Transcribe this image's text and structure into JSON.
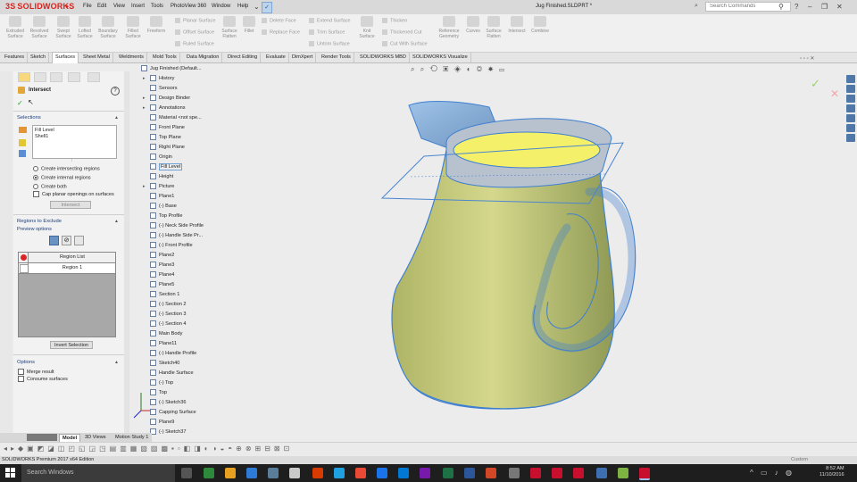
{
  "app": {
    "brand": "SOLIDWORKS",
    "brand_prefix": "3S",
    "document_title": "Jug Finished.SLDPRT *"
  },
  "menu": [
    "File",
    "Edit",
    "View",
    "Insert",
    "Tools",
    "PhotoView 360",
    "Window",
    "Help"
  ],
  "search": {
    "placeholder": "Search Commands"
  },
  "ribbon": {
    "big_buttons": [
      {
        "label": "Extruded Surface"
      },
      {
        "label": "Revolved Surface"
      },
      {
        "label": "Swept Surface"
      },
      {
        "label": "Lofted Surface"
      },
      {
        "label": "Boundary Surface"
      },
      {
        "label": "Filled Surface"
      },
      {
        "label": "Freeform"
      }
    ],
    "small_col1": [
      "Planar Surface",
      "Offset Surface",
      "Ruled Surface"
    ],
    "big2": [
      {
        "label": "Surface Flatten"
      },
      {
        "label": "Fillet"
      }
    ],
    "small_col2": [
      "Delete Face",
      "Replace Face"
    ],
    "small_col3": [
      "Extend Surface",
      "Trim Surface",
      "Untrim Surface"
    ],
    "big3": [
      {
        "label": "Knit Surface"
      }
    ],
    "small_col4": [
      "Thicken",
      "Thickened Cut",
      "Cut With Surface"
    ],
    "big4": [
      {
        "label": "Reference Geometry"
      },
      {
        "label": "Curves"
      },
      {
        "label": "Surface Flatten"
      },
      {
        "label": "Intersect"
      },
      {
        "label": "Combine"
      }
    ]
  },
  "tabs": [
    "Features",
    "Sketch",
    "Surfaces",
    "Sheet Metal",
    "Weldments",
    "Mold Tools",
    "Data Migration",
    "Direct Editing",
    "Evaluate",
    "DimXpert",
    "Render Tools",
    "SOLIDWORKS MBD",
    "SOLIDWORKS Visualize"
  ],
  "active_tab": "Surfaces",
  "property_manager": {
    "title": "Intersect",
    "help": "?",
    "selections_header": "Selections",
    "selections": [
      "Fill Level",
      "Shell1"
    ],
    "options_radio": [
      {
        "label": "Create intersecting regions",
        "checked": false
      },
      {
        "label": "Create internal regions",
        "checked": true
      },
      {
        "label": "Create both",
        "checked": false
      }
    ],
    "cap_label": "Cap planar openings on surfaces",
    "intersect_button": "Intersect",
    "regions_header": "Regions to Exclude",
    "preview_label": "Preview options",
    "region_list_header": "Region List",
    "region_row": "Region   1",
    "invert_button": "Invert Selection",
    "options_header": "Options",
    "merge_label": "Merge result",
    "consume_label": "Consume surfaces"
  },
  "tree": [
    {
      "label": "Jug Finished  (Default...",
      "arrow": "",
      "indent": 0
    },
    {
      "label": "History",
      "arrow": "▸",
      "indent": 1
    },
    {
      "label": "Sensors",
      "arrow": "",
      "indent": 1
    },
    {
      "label": "Design Binder",
      "arrow": "▸",
      "indent": 1
    },
    {
      "label": "Annotations",
      "arrow": "▸",
      "indent": 1
    },
    {
      "label": "Material <not spe...",
      "arrow": "",
      "indent": 1
    },
    {
      "label": "Front Plane",
      "arrow": "",
      "indent": 1
    },
    {
      "label": "Top Plane",
      "arrow": "",
      "indent": 1
    },
    {
      "label": "Right Plane",
      "arrow": "",
      "indent": 1
    },
    {
      "label": "Origin",
      "arrow": "",
      "indent": 1
    },
    {
      "label": "Fill Level",
      "arrow": "",
      "indent": 1,
      "highlight": true
    },
    {
      "label": "Height",
      "arrow": "",
      "indent": 1
    },
    {
      "label": "Picture",
      "arrow": "▸",
      "indent": 1
    },
    {
      "label": "Plane1",
      "arrow": "",
      "indent": 1
    },
    {
      "label": "(-) Base",
      "arrow": "",
      "indent": 1
    },
    {
      "label": "Top Profile",
      "arrow": "",
      "indent": 1
    },
    {
      "label": "(-) Neck Side Profile",
      "arrow": "",
      "indent": 1
    },
    {
      "label": "(-) Handle Side Pr...",
      "arrow": "",
      "indent": 1
    },
    {
      "label": "(-) Front Profile",
      "arrow": "",
      "indent": 1
    },
    {
      "label": "Plane2",
      "arrow": "",
      "indent": 1
    },
    {
      "label": "Plane3",
      "arrow": "",
      "indent": 1
    },
    {
      "label": "Plane4",
      "arrow": "",
      "indent": 1
    },
    {
      "label": "Plane5",
      "arrow": "",
      "indent": 1
    },
    {
      "label": "Section 1",
      "arrow": "",
      "indent": 1
    },
    {
      "label": "(-) Section 2",
      "arrow": "",
      "indent": 1
    },
    {
      "label": "(-) Section 3",
      "arrow": "",
      "indent": 1
    },
    {
      "label": "(-) Section 4",
      "arrow": "",
      "indent": 1
    },
    {
      "label": "Main Body",
      "arrow": "",
      "indent": 1
    },
    {
      "label": "Plane11",
      "arrow": "",
      "indent": 1
    },
    {
      "label": "(-) Handle Profile",
      "arrow": "",
      "indent": 1
    },
    {
      "label": "Sketch40",
      "arrow": "",
      "indent": 1
    },
    {
      "label": "Handle Surface",
      "arrow": "",
      "indent": 1
    },
    {
      "label": "(-) Top",
      "arrow": "",
      "indent": 1
    },
    {
      "label": "Top",
      "arrow": "",
      "indent": 0
    },
    {
      "label": "(-) Sketch36",
      "arrow": "",
      "indent": 1
    },
    {
      "label": "Capping Surface",
      "arrow": "",
      "indent": 1
    },
    {
      "label": "Plane9",
      "arrow": "",
      "indent": 1
    },
    {
      "label": "(-) Sketch37",
      "arrow": "",
      "indent": 1
    }
  ],
  "bottom_tabs": [
    "Model",
    "3D Views",
    "Motion Study 1"
  ],
  "status": "SOLIDWORKS Premium 2017 x64 Edition",
  "status_right": "Custom",
  "taskbar": {
    "search": "Search Windows",
    "time": "8:52 AM",
    "date": "11/10/2016"
  },
  "colors": {
    "brand": "#d8231e",
    "jug_body": "#c8cc88",
    "jug_edge": "#3f7fd0",
    "plane": "#4b86cf",
    "fill_level": "#f4f06a"
  }
}
